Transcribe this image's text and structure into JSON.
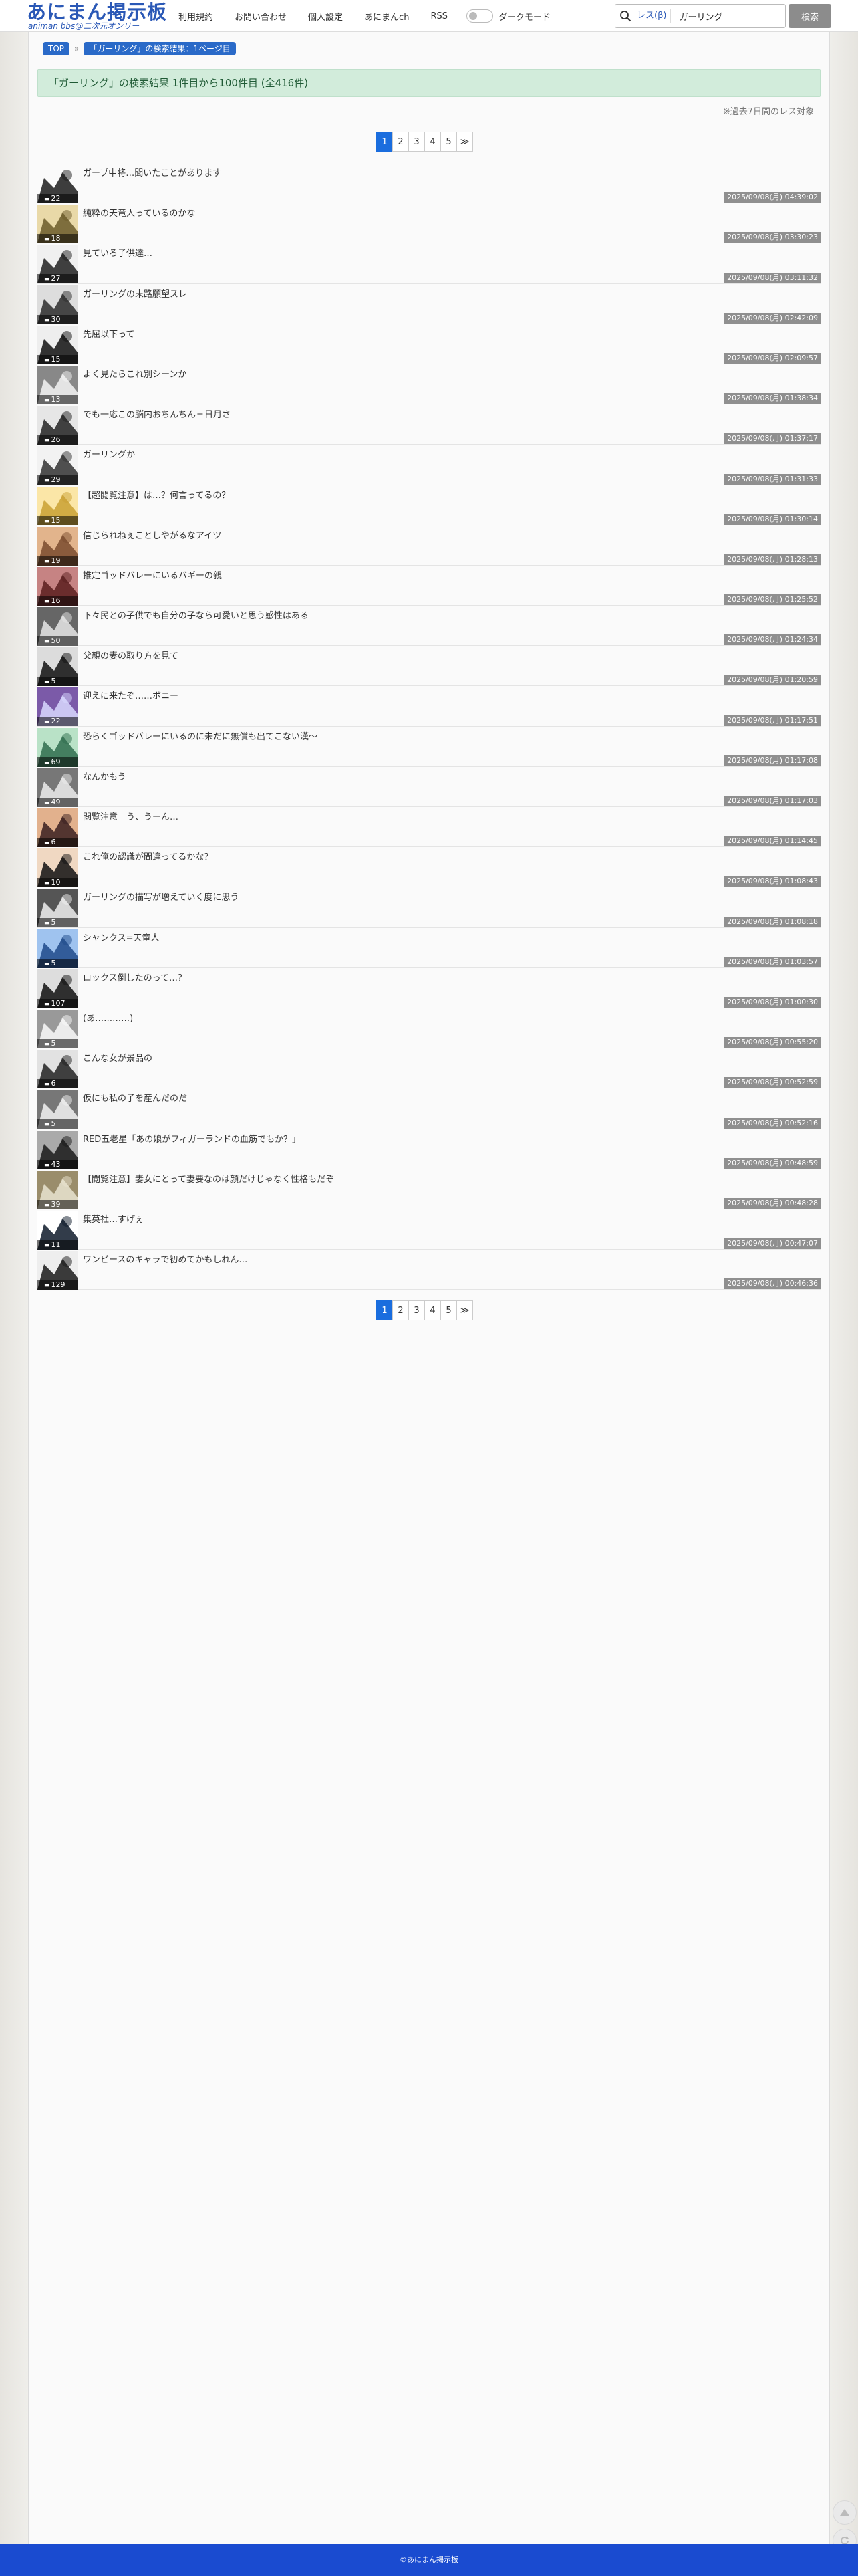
{
  "header": {
    "logo_text": "あにまん掲示板",
    "logo_sub": "animan bbs@二次元オンリー",
    "nav": [
      "利用規約",
      "お問い合わせ",
      "個人設定",
      "あにまんch",
      "RSS"
    ],
    "dark_mode_label": "ダークモード",
    "search_scope": "レス(β)",
    "search_value": "ガーリング",
    "search_button": "検索",
    "icons": {
      "search": "magnifier-icon"
    }
  },
  "breadcrumb": {
    "top": "TOP",
    "separator": "»",
    "current": "「ガーリング」の検索結果：1ページ目"
  },
  "result": {
    "summary": "「ガーリング」の検索結果 1件目から100件目 (全416件)",
    "note": "※過去7日間のレス対象"
  },
  "pagination": {
    "pages": [
      "1",
      "2",
      "3",
      "4",
      "5",
      "≫"
    ],
    "active": "1"
  },
  "threads": [
    {
      "title": "ガープ中将…聞いたことがあります",
      "res": "22",
      "time": "2025/09/08(月) 04:39:02"
    },
    {
      "title": "純粋の天竜人っているのかな",
      "res": "18",
      "time": "2025/09/08(月) 03:30:23"
    },
    {
      "title": "見ていろ子供達…",
      "res": "27",
      "time": "2025/09/08(月) 03:11:32"
    },
    {
      "title": "ガーリングの末路願望スレ",
      "res": "30",
      "time": "2025/09/08(月) 02:42:09"
    },
    {
      "title": "先屈以下って",
      "res": "15",
      "time": "2025/09/08(月) 02:09:57"
    },
    {
      "title": "よく見たらこれ別シーンか",
      "res": "13",
      "time": "2025/09/08(月) 01:38:34"
    },
    {
      "title": "でも一応この脳内おちんちん三日月さ",
      "res": "26",
      "time": "2025/09/08(月) 01:37:17"
    },
    {
      "title": "ガーリングか",
      "res": "29",
      "time": "2025/09/08(月) 01:31:33"
    },
    {
      "title": "【超閲覧注意】は…？何言ってるの？",
      "res": "15",
      "time": "2025/09/08(月) 01:30:14"
    },
    {
      "title": "信じられねぇことしやがるなアイツ",
      "res": "19",
      "time": "2025/09/08(月) 01:28:13"
    },
    {
      "title": "推定ゴッドバレーにいるバギーの親",
      "res": "16",
      "time": "2025/09/08(月) 01:25:52"
    },
    {
      "title": "下々民との子供でも自分の子なら可愛いと思う感性はある",
      "res": "50",
      "time": "2025/09/08(月) 01:24:34"
    },
    {
      "title": "父親の妻の取り方を見て",
      "res": "5",
      "time": "2025/09/08(月) 01:20:59"
    },
    {
      "title": "迎えに来たぞ……ボニー",
      "res": "22",
      "time": "2025/09/08(月) 01:17:51"
    },
    {
      "title": "恐らくゴッドバレーにいるのに未だに無償も出てこない漢〜",
      "res": "69",
      "time": "2025/09/08(月) 01:17:08"
    },
    {
      "title": "なんかもう",
      "res": "49",
      "time": "2025/09/08(月) 01:17:03"
    },
    {
      "title": "閲覧注意　う、うーん…",
      "res": "6",
      "time": "2025/09/08(月) 01:14:45"
    },
    {
      "title": "これ俺の認識が間違ってるかな？",
      "res": "10",
      "time": "2025/09/08(月) 01:08:43"
    },
    {
      "title": "ガーリングの描写が増えていく度に思う",
      "res": "5",
      "time": "2025/09/08(月) 01:08:18"
    },
    {
      "title": "シャンクス=天竜人",
      "res": "5",
      "time": "2025/09/08(月) 01:03:57"
    },
    {
      "title": "ロックス倒したのって…？",
      "res": "107",
      "time": "2025/09/08(月) 01:00:30"
    },
    {
      "title": "(あ…………)",
      "res": "5",
      "time": "2025/09/08(月) 00:55:20"
    },
    {
      "title": "こんな女が景品の",
      "res": "6",
      "time": "2025/09/08(月) 00:52:59"
    },
    {
      "title": "仮にも私の子を産んだのだ",
      "res": "5",
      "time": "2025/09/08(月) 00:52:16"
    },
    {
      "title": "RED五老星「あの娘がフィガーランドの血筋でもか？」",
      "res": "43",
      "time": "2025/09/08(月) 00:48:59"
    },
    {
      "title": "【閲覧注意】妻女にとって妻要なのは顔だけじゃなく性格もだぞ",
      "res": "39",
      "time": "2025/09/08(月) 00:48:28"
    },
    {
      "title": "集英社…すげぇ",
      "res": "11",
      "time": "2025/09/08(月) 00:47:07"
    },
    {
      "title": "ワンピースのキャラで初めてかもしれん…",
      "res": "129",
      "time": "2025/09/08(月) 00:46:36"
    }
  ],
  "footer": {
    "text": "©あにまん掲示板"
  },
  "colors": {
    "brand": "#2a58b6",
    "breadcrumb": "#2a6ac8",
    "result_bg": "#d2ecdb",
    "pager_active": "#1a6dde",
    "footer": "#1a4bd0"
  }
}
